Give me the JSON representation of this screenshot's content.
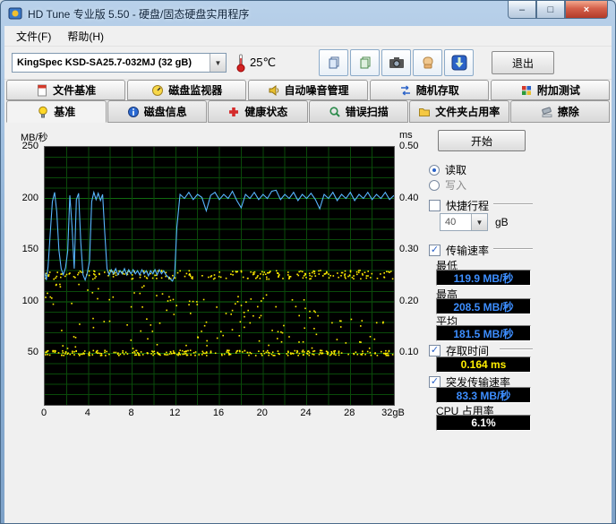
{
  "window": {
    "title": "HD Tune 专业版 5.50 - 硬盘/固态硬盘实用程序",
    "controls": {
      "minimize_icon": "–",
      "maximize_icon": "□",
      "close_icon": "×"
    }
  },
  "menu": {
    "file": "文件(F)",
    "help": "帮助(H)"
  },
  "toolbar": {
    "drive_selected": "KingSpec KSD-SA25.7-032MJ (32 gB)",
    "temperature": "25℃",
    "buttons": [
      {
        "icon": "copy-text-icon"
      },
      {
        "icon": "copy-image-icon"
      },
      {
        "icon": "screenshot-camera-icon"
      },
      {
        "icon": "donate-hand-icon"
      },
      {
        "icon": "save-download-icon"
      }
    ],
    "exit_label": "退出"
  },
  "tabs_top": [
    {
      "label": "文件基准",
      "icon": "file-benchmark-icon"
    },
    {
      "label": "磁盘监视器",
      "icon": "disk-monitor-icon"
    },
    {
      "label": "自动噪音管理",
      "icon": "noise-management-icon"
    },
    {
      "label": "随机存取",
      "icon": "random-access-icon"
    },
    {
      "label": "附加测试",
      "icon": "extra-tests-icon"
    }
  ],
  "tabs_main": [
    {
      "label": "基准",
      "icon": "benchmark-bulb-icon",
      "active": true
    },
    {
      "label": "磁盘信息",
      "icon": "disk-info-icon",
      "active": false
    },
    {
      "label": "健康状态",
      "icon": "health-icon",
      "active": false
    },
    {
      "label": "错误扫描",
      "icon": "error-scan-icon",
      "active": false
    },
    {
      "label": "文件夹占用率",
      "icon": "folder-usage-icon",
      "active": false
    },
    {
      "label": "擦除",
      "icon": "erase-icon",
      "active": false
    }
  ],
  "panel": {
    "start_label": "开始",
    "read_label": "读取",
    "write_label": "写入",
    "short_stroke_label": "快捷行程",
    "short_stroke_value": "40",
    "short_stroke_unit": "gB",
    "transfer_label": "传输速率",
    "min_label": "最低",
    "min_value": "119.9 MB/秒",
    "max_label": "最高",
    "max_value": "208.5 MB/秒",
    "avg_label": "平均",
    "avg_value": "181.5 MB/秒",
    "access_label": "存取时间",
    "access_value": "0.164 ms",
    "burst_label": "突发传输速率",
    "burst_value": "83.3 MB/秒",
    "cpu_label": "CPU 占用率",
    "cpu_value": "6.1%"
  },
  "colors": {
    "value_blue": "#3d8eff",
    "value_yellow": "#ffee00",
    "value_white": "#ffffff"
  },
  "chart_data": {
    "type": "line+scatter",
    "left_axis": {
      "label": "MB/秒",
      "min": 0,
      "max": 250,
      "ticks": [
        50,
        100,
        150,
        200,
        250
      ],
      "grid_step": 10
    },
    "right_axis": {
      "label": "ms",
      "min": 0,
      "max": 0.5,
      "ticks": [
        0.1,
        0.2,
        0.3,
        0.4,
        0.5
      ]
    },
    "x_axis": {
      "min": 0,
      "max": 32,
      "ticks": [
        0,
        4,
        8,
        12,
        16,
        20,
        24,
        28
      ],
      "end_label": "32gB",
      "grid_step": 2
    },
    "grid": {
      "color": "#0a4a0a",
      "major_color": "#106a10",
      "bg": "#000000"
    },
    "series": [
      {
        "name": "传输速率",
        "type": "line",
        "axis": "left",
        "color": "#58b6ff",
        "points": [
          [
            0,
            128
          ],
          [
            0.15,
            121
          ],
          [
            0.3,
            134
          ],
          [
            0.5,
            166
          ],
          [
            0.7,
            197
          ],
          [
            0.9,
            206
          ],
          [
            1.1,
            187
          ],
          [
            1.3,
            150
          ],
          [
            1.5,
            132
          ],
          [
            1.7,
            126
          ],
          [
            1.9,
            133
          ],
          [
            2.1,
            149
          ],
          [
            2.3,
            203
          ],
          [
            2.5,
            172
          ],
          [
            2.7,
            132
          ],
          [
            2.9,
            199
          ],
          [
            3.1,
            205
          ],
          [
            3.3,
            158
          ],
          [
            3.5,
            126
          ],
          [
            3.7,
            121
          ],
          [
            3.9,
            128
          ],
          [
            4.1,
            139
          ],
          [
            4.3,
            197
          ],
          [
            4.5,
            206
          ],
          [
            4.7,
            199
          ],
          [
            4.9,
            205
          ],
          [
            5.1,
            198
          ],
          [
            5.3,
            204
          ],
          [
            5.5,
            167
          ],
          [
            5.7,
            132
          ],
          [
            5.9,
            126
          ],
          [
            6.1,
            131
          ],
          [
            6.3,
            127
          ],
          [
            6.5,
            132
          ],
          [
            6.7,
            126
          ],
          [
            6.9,
            130
          ],
          [
            7.1,
            127
          ],
          [
            7.3,
            132
          ],
          [
            7.5,
            126
          ],
          [
            7.7,
            131
          ],
          [
            7.9,
            127
          ],
          [
            8.1,
            131
          ],
          [
            8.3,
            127
          ],
          [
            8.5,
            130
          ],
          [
            8.7,
            126
          ],
          [
            8.9,
            131
          ],
          [
            9.1,
            127
          ],
          [
            9.3,
            130
          ],
          [
            9.5,
            125
          ],
          [
            9.7,
            130
          ],
          [
            9.9,
            127
          ],
          [
            10.1,
            131
          ],
          [
            10.3,
            126
          ],
          [
            10.5,
            131
          ],
          [
            10.7,
            127
          ],
          [
            10.9,
            130
          ],
          [
            11.1,
            126
          ],
          [
            11.3,
            124
          ],
          [
            11.5,
            122
          ],
          [
            11.7,
            120
          ],
          [
            11.9,
            125
          ],
          [
            12.1,
            172
          ],
          [
            12.4,
            204
          ],
          [
            12.8,
            200
          ],
          [
            13.2,
            206
          ],
          [
            13.6,
            199
          ],
          [
            14,
            204
          ],
          [
            14.4,
            201
          ],
          [
            14.8,
            188
          ],
          [
            15.2,
            203
          ],
          [
            15.6,
            206
          ],
          [
            16,
            199
          ],
          [
            16.4,
            204
          ],
          [
            16.8,
            200
          ],
          [
            17.2,
            207
          ],
          [
            17.6,
            198
          ],
          [
            18,
            191
          ],
          [
            18.4,
            204
          ],
          [
            18.8,
            200
          ],
          [
            19.2,
            206
          ],
          [
            19.6,
            199
          ],
          [
            20,
            204
          ],
          [
            20.4,
            200
          ],
          [
            20.8,
            207
          ],
          [
            21.2,
            208
          ],
          [
            21.6,
            199
          ],
          [
            22,
            204
          ],
          [
            22.4,
            200
          ],
          [
            22.8,
            206
          ],
          [
            23.2,
            198
          ],
          [
            23.6,
            204
          ],
          [
            24,
            200
          ],
          [
            24.4,
            205
          ],
          [
            24.8,
            199
          ],
          [
            25.2,
            190
          ],
          [
            25.6,
            204
          ],
          [
            26,
            200
          ],
          [
            26.4,
            206
          ],
          [
            26.8,
            198
          ],
          [
            27.2,
            204
          ],
          [
            27.6,
            200
          ],
          [
            28,
            206
          ],
          [
            28.4,
            198
          ],
          [
            28.8,
            204
          ],
          [
            29.2,
            200
          ],
          [
            29.6,
            206
          ],
          [
            30,
            199
          ],
          [
            30.4,
            204
          ],
          [
            30.8,
            200
          ],
          [
            31.2,
            206
          ],
          [
            31.6,
            199
          ],
          [
            32,
            203
          ]
        ]
      },
      {
        "name": "存取时间",
        "type": "scatter",
        "axis": "right",
        "color": "#ffee00",
        "bands": [
          {
            "ms_min": 0.245,
            "ms_max": 0.262,
            "x_min": 0,
            "x_max": 32,
            "count": 240
          },
          {
            "ms_min": 0.097,
            "ms_max": 0.107,
            "x_min": 0,
            "x_max": 32,
            "count": 280
          },
          {
            "ms_min": 0.11,
            "ms_max": 0.17,
            "x_min": 0,
            "x_max": 32,
            "count": 70
          },
          {
            "ms_min": 0.17,
            "ms_max": 0.215,
            "x_min": 11,
            "x_max": 25,
            "count": 45
          },
          {
            "ms_min": 0.19,
            "ms_max": 0.235,
            "x_min": 0,
            "x_max": 11,
            "count": 25
          }
        ]
      }
    ]
  }
}
